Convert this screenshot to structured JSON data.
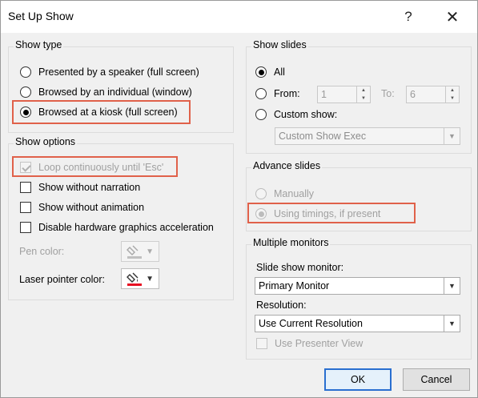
{
  "title": "Set Up Show",
  "help_glyph": "?",
  "close_glyph": "✕",
  "show_type": {
    "label": "Show type",
    "options": [
      "Presented by a speaker (full screen)",
      "Browsed by an individual (window)",
      "Browsed at a kiosk (full screen)"
    ],
    "selected": 2
  },
  "show_options": {
    "label": "Show options",
    "loop": "Loop continuously until 'Esc'",
    "without_narration": "Show without narration",
    "without_animation": "Show without animation",
    "disable_hw": "Disable hardware graphics acceleration",
    "pen_color": "Pen color:",
    "laser_color": "Laser pointer color:"
  },
  "show_slides": {
    "label": "Show slides",
    "all": "All",
    "from": "From:",
    "from_value": "1",
    "to": "To:",
    "to_value": "6",
    "custom_show": "Custom show:",
    "custom_show_value": "Custom Show Exec"
  },
  "advance_slides": {
    "label": "Advance slides",
    "manually": "Manually",
    "using_timings": "Using timings, if present"
  },
  "multiple_monitors": {
    "label": "Multiple monitors",
    "slide_show_monitor": "Slide show monitor:",
    "monitor_value": "Primary Monitor",
    "resolution": "Resolution:",
    "resolution_value": "Use Current Resolution",
    "presenter_view": "Use Presenter View"
  },
  "buttons": {
    "ok": "OK",
    "cancel": "Cancel"
  },
  "colors": {
    "highlight": "#e0614a",
    "laser": "#e81123",
    "primary_border": "#2a6fd0"
  }
}
